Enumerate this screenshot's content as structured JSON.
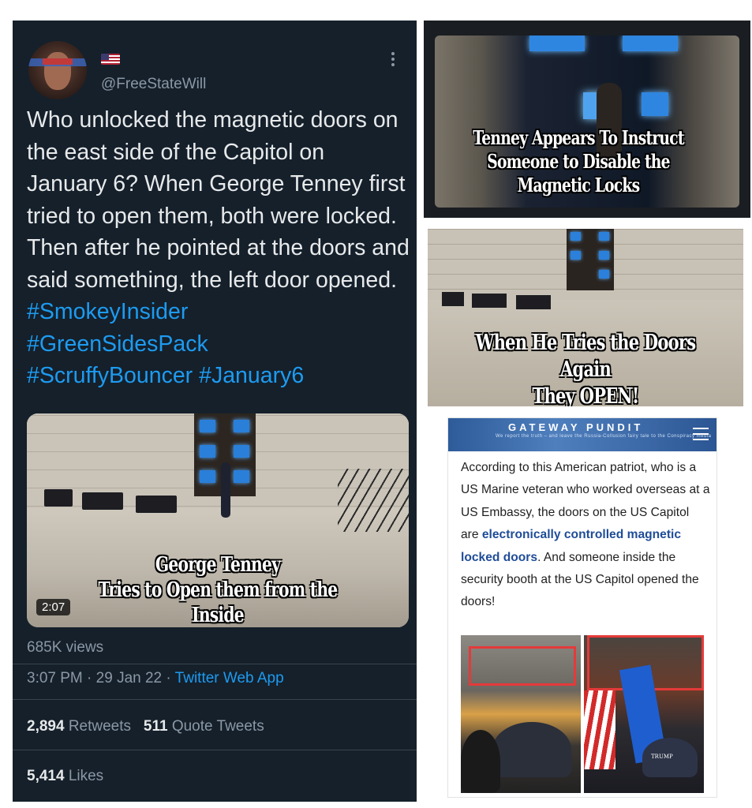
{
  "tweet": {
    "handle": "@FreeStateWill",
    "text_plain": "Who unlocked the magnetic doors on the east side of the Capitol on January 6? When George Tenney first tried to open them, both were locked. Then after he pointed at the doors and said something, the left door opened. ",
    "hashtags": [
      "#SmokeyInsider",
      "#GreenSidesPack",
      "#ScruffyBouncer",
      "#January6"
    ],
    "video": {
      "caption_line1": "George Tenney",
      "caption_line2": "Tries to Open them from the Inside",
      "duration": "2:07"
    },
    "views": "685K views",
    "time": "3:07 PM",
    "date": "29 Jan 22",
    "app": "Twitter Web App",
    "separator": " · ",
    "retweets_count": "2,894",
    "retweets_label": "Retweets",
    "quotes_count": "511",
    "quotes_label": "Quote Tweets",
    "likes_count": "5,414",
    "likes_label": "Likes",
    "icons": {
      "more": "more-vertical-icon",
      "flag": "us-flag-icon",
      "avatar": "avatar"
    }
  },
  "images": {
    "img1_caption_line1": "Tenney Appears To Instruct",
    "img1_caption_line2": "Someone to Disable the Magnetic Locks",
    "img2_caption_line1": "When He Tries the Doors Again",
    "img2_caption_line2": "They OPEN!"
  },
  "article": {
    "brand": "GATEWAY PUNDIT",
    "tagline": "We report the truth – and leave the Russia-Collusion fairy tale to the Conspiracy media",
    "text_before": "According to this American patriot, who is a US Marine veteran who worked overseas at a US Embassy, the doors on the US Capitol are ",
    "link_text": "electronically controlled magnetic locked doors",
    "text_after": ". And someone inside the security booth at the US Capitol opened the doors!",
    "hat_text": "TRUMP"
  },
  "colors": {
    "tweet_bg": "#15202b",
    "tweet_text": "#e7e9ea",
    "muted": "#8b98a5",
    "link": "#1d9bf0",
    "article_link": "#1f4c98",
    "highlight_box": "#e43a3a"
  }
}
